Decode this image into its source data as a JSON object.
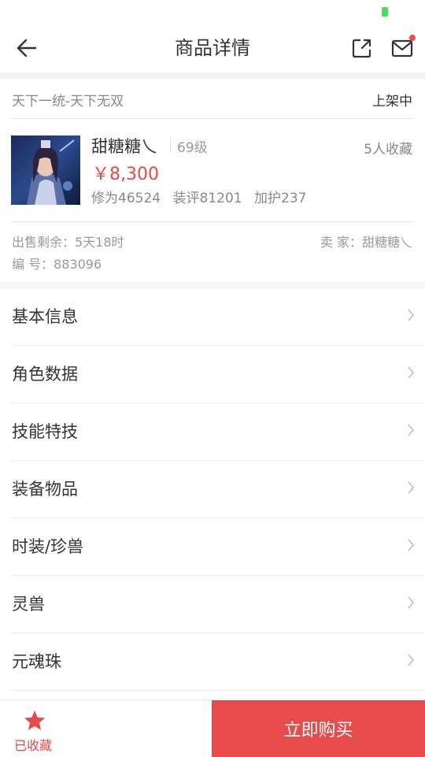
{
  "nav": {
    "title": "商品详情",
    "back_icon": "arrow-left-icon",
    "share_icon": "share-icon",
    "mail_icon": "mail-icon"
  },
  "listing": {
    "server": "天下一统-天下无双",
    "status": "上架中"
  },
  "product": {
    "name": "甜糖糖乀",
    "level": "69级",
    "favorites": "5人收藏",
    "price": "￥8,300",
    "stats": [
      "修为46524",
      "装评81201",
      "加护237"
    ]
  },
  "meta": {
    "time_left": "出售剩余：5天18时",
    "seller": "卖 家：甜糖糖乀",
    "item_id": "编 号：883096"
  },
  "menu": {
    "items": [
      {
        "label": "基本信息"
      },
      {
        "label": "角色数据"
      },
      {
        "label": "技能特技"
      },
      {
        "label": "装备物品"
      },
      {
        "label": "时装/珍兽"
      },
      {
        "label": "灵兽"
      },
      {
        "label": "元魂珠"
      }
    ]
  },
  "bottom": {
    "favorite_label": "已收藏",
    "buy_label": "立即购买"
  },
  "colors": {
    "accent": "#e84b4b",
    "price": "#e84a4a",
    "battery": "#4cd964"
  }
}
